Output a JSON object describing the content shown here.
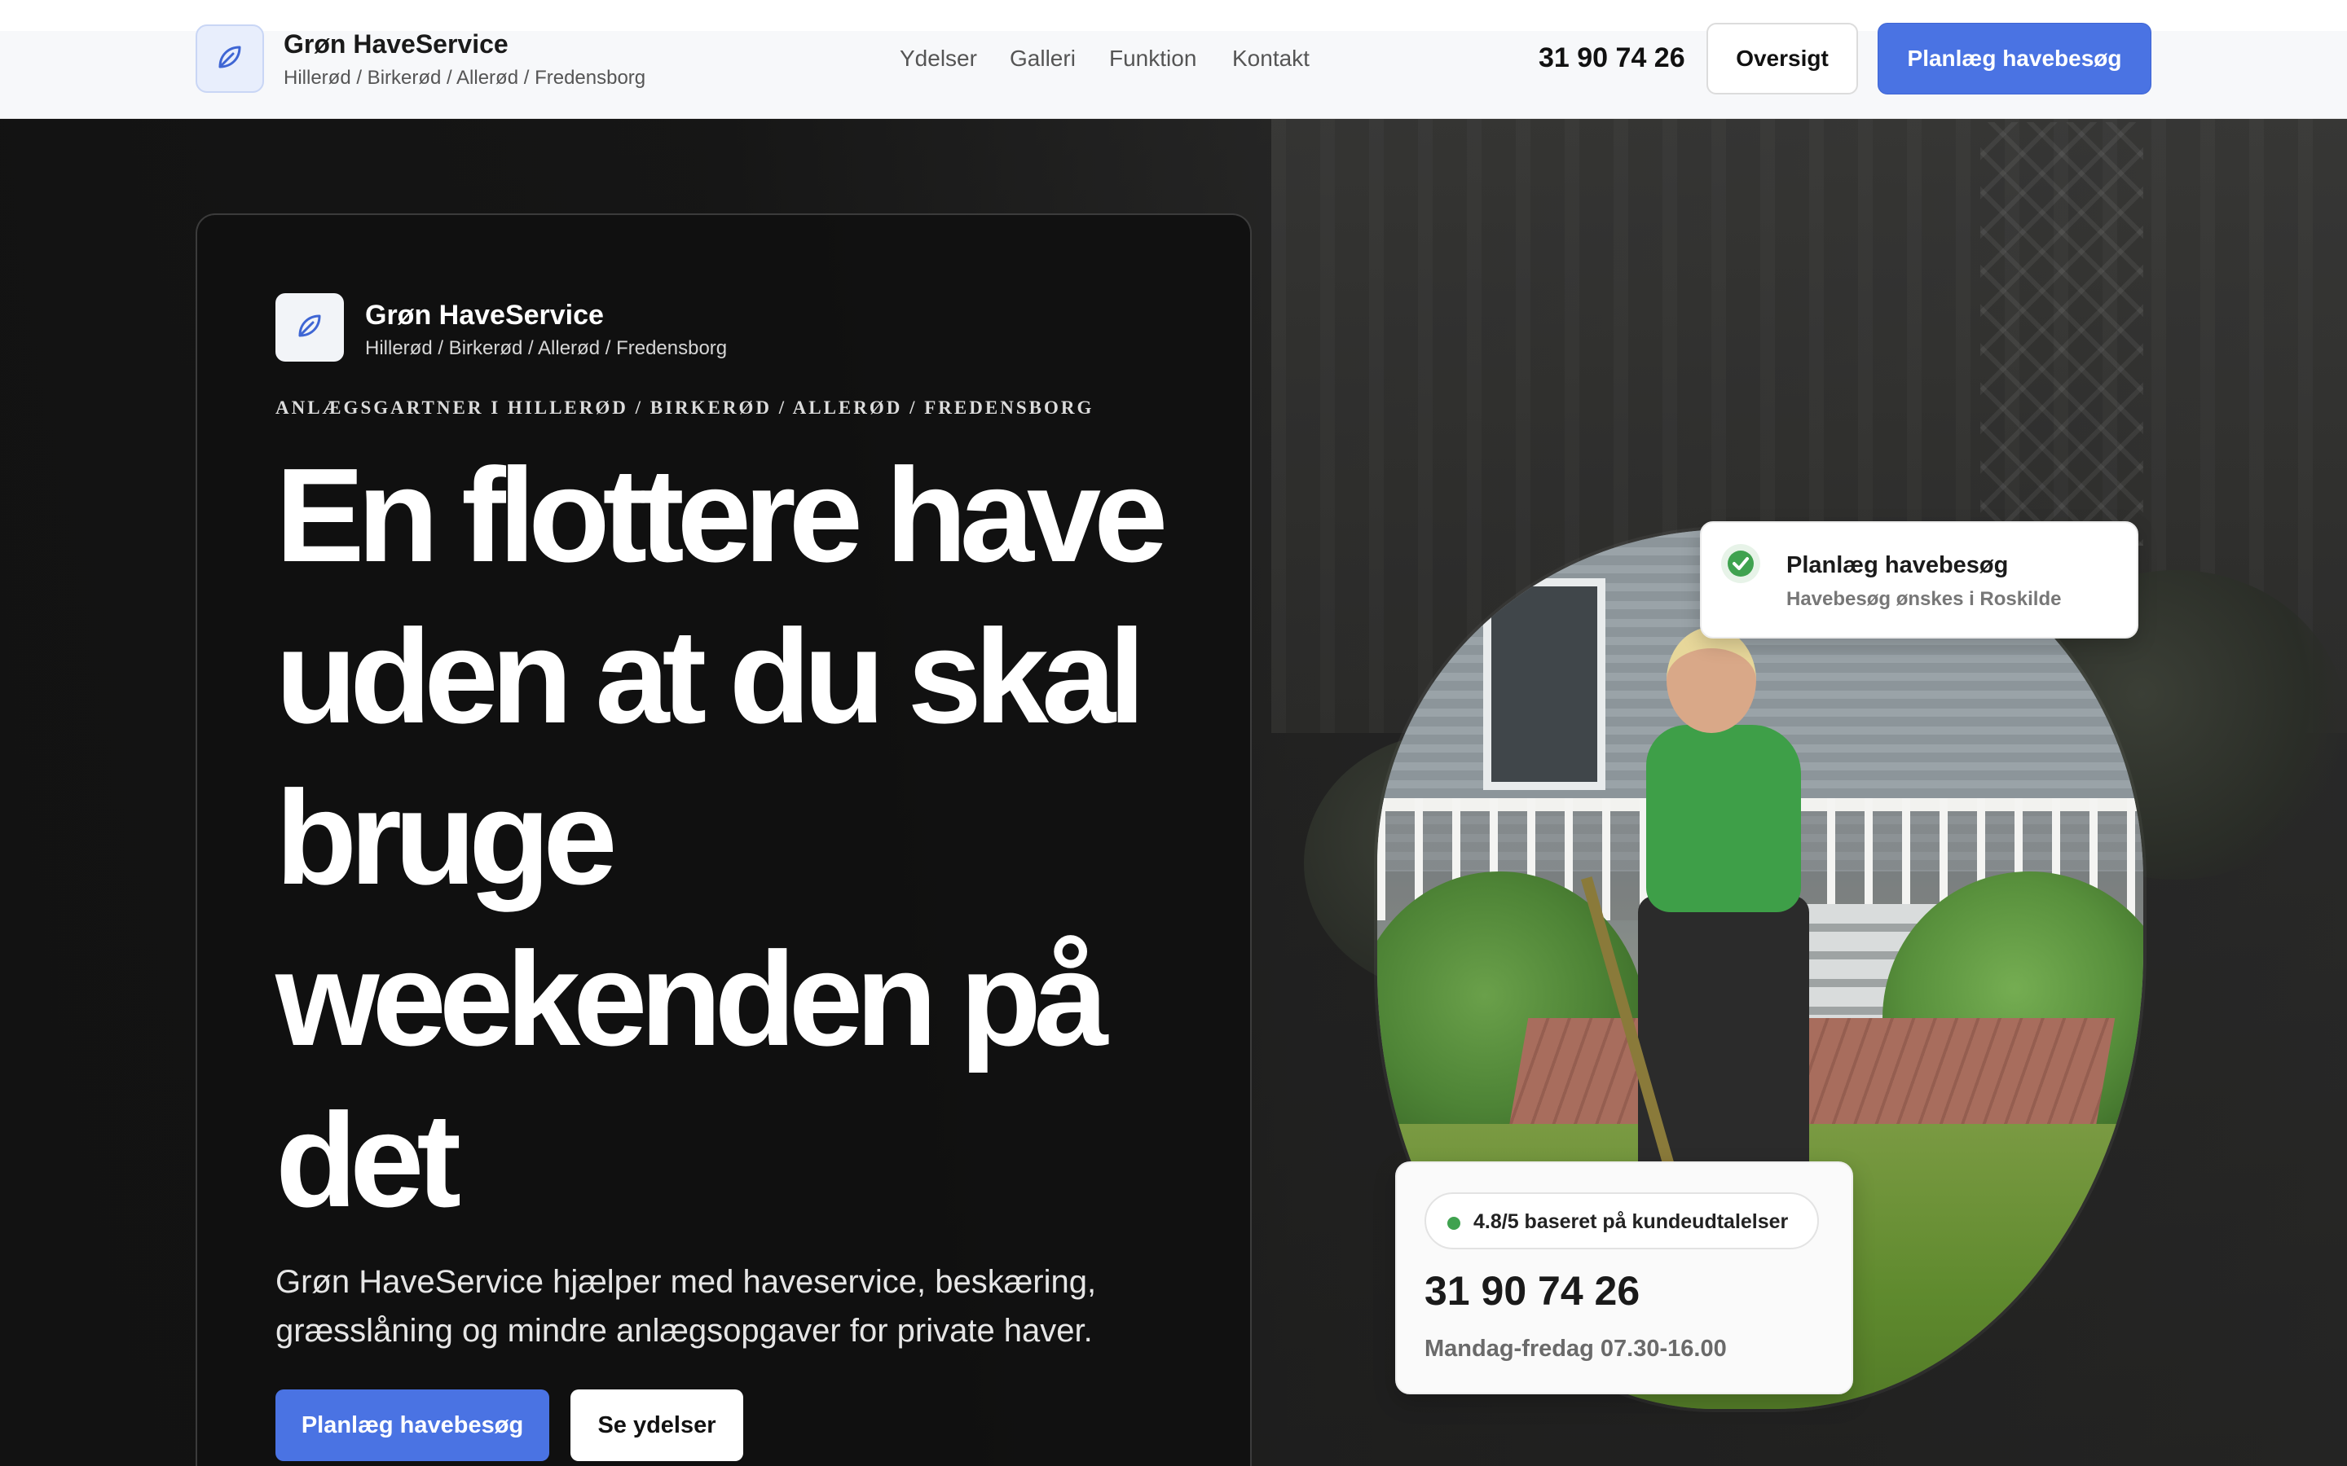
{
  "brand": {
    "name": "Grøn HaveService",
    "locations": "Hillerød / Birkerød / Allerød / Fredensborg",
    "logo_icon": "leaf-icon",
    "accent_color": "#4a73e3"
  },
  "nav": {
    "links": [
      "Ydelser",
      "Galleri",
      "Funktion",
      "Kontakt"
    ],
    "phone": "31 90 74 26",
    "overview_button": "Oversigt",
    "cta_button": "Planlæg havebesøg"
  },
  "hero": {
    "eyebrow": "ANLÆGSGARTNER I HILLERØD / BIRKERØD / ALLERØD / FREDENSBORG",
    "headline": "En flottere have uden at du skal bruge weekenden på det",
    "lede": "Grøn HaveService hjælper med haveservice, beskæring, græsslåning og mindre anlægsopgaver for private haver.",
    "primary_button": "Planlæg havebesøg",
    "secondary_button": "Se ydelser"
  },
  "floating_top": {
    "icon": "check-circle-icon",
    "title": "Planlæg havebesøg",
    "subtitle": "Havebesøg ønskes i Roskilde"
  },
  "floating_bottom": {
    "rating": "4.8/5 baseret på kundeudtalelser",
    "phone": "31 90 74 26",
    "hours": "Mandag-fredag 07.30-16.00"
  }
}
